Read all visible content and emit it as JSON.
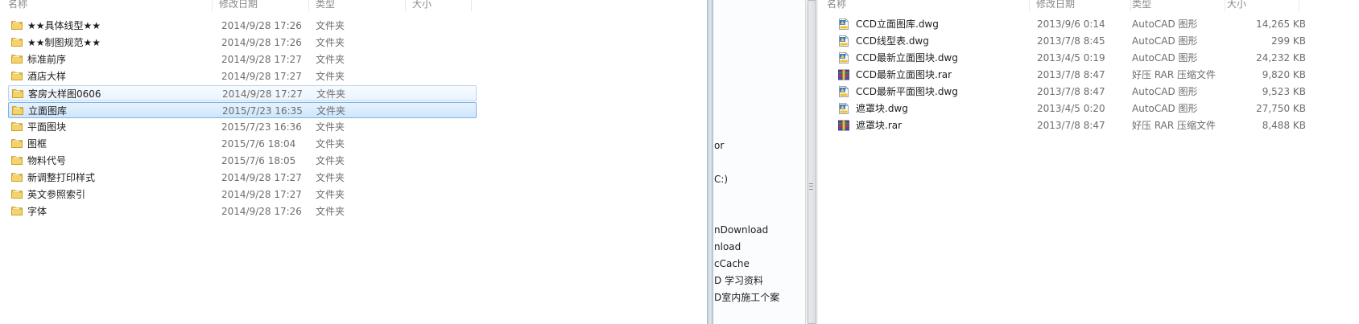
{
  "left_pane": {
    "columns": [
      "名称",
      "修改日期",
      "类型",
      "大小"
    ],
    "rows": [
      {
        "name": "★★具体线型★★",
        "date": "2014/9/28 17:26",
        "type": "文件夹"
      },
      {
        "name": "★★制图规范★★",
        "date": "2014/9/28 17:26",
        "type": "文件夹"
      },
      {
        "name": "标准前序",
        "date": "2014/9/28 17:27",
        "type": "文件夹"
      },
      {
        "name": "酒店大样",
        "date": "2014/9/28 17:27",
        "type": "文件夹"
      },
      {
        "name": "客房大样图0606",
        "date": "2014/9/28 17:27",
        "type": "文件夹"
      },
      {
        "name": "立面图库",
        "date": "2015/7/23 16:35",
        "type": "文件夹"
      },
      {
        "name": "平面图块",
        "date": "2015/7/23 16:36",
        "type": "文件夹"
      },
      {
        "name": "图框",
        "date": "2015/7/6 18:04",
        "type": "文件夹"
      },
      {
        "name": "物料代号",
        "date": "2015/7/6 18:05",
        "type": "文件夹"
      },
      {
        "name": "新调整打印样式",
        "date": "2014/9/28 17:27",
        "type": "文件夹"
      },
      {
        "name": "英文参照索引",
        "date": "2014/9/28 17:27",
        "type": "文件夹"
      },
      {
        "name": "字体",
        "date": "2014/9/28 17:26",
        "type": "文件夹"
      }
    ],
    "hover_row": 4,
    "selected_row": 5
  },
  "nav_pane": {
    "items": [
      "or",
      "C:)",
      "nDownload",
      "nload",
      "cCache",
      "D 学习资料",
      "D室内施工个案"
    ]
  },
  "right_pane": {
    "columns": [
      "名称",
      "修改日期",
      "类型",
      "大小"
    ],
    "rows": [
      {
        "name": "CCD立面图库.dwg",
        "date": "2013/9/6 0:14",
        "type": "AutoCAD 图形",
        "size": "14,265 KB",
        "icon": "dwg-icon"
      },
      {
        "name": "CCD线型表.dwg",
        "date": "2013/7/8 8:45",
        "type": "AutoCAD 图形",
        "size": "299 KB",
        "icon": "dwg-icon"
      },
      {
        "name": "CCD最新立面图块.dwg",
        "date": "2013/4/5 0:19",
        "type": "AutoCAD 图形",
        "size": "24,232 KB",
        "icon": "dwg-icon"
      },
      {
        "name": "CCD最新立面图块.rar",
        "date": "2013/7/8 8:47",
        "type": "好压 RAR 压缩文件",
        "size": "9,820 KB",
        "icon": "rar-icon"
      },
      {
        "name": "CCD最新平面图块.dwg",
        "date": "2013/7/8 8:47",
        "type": "AutoCAD 图形",
        "size": "9,523 KB",
        "icon": "dwg-icon"
      },
      {
        "name": "遮罩块.dwg",
        "date": "2013/4/5 0:20",
        "type": "AutoCAD 图形",
        "size": "27,750 KB",
        "icon": "dwg-icon"
      },
      {
        "name": "遮罩块.rar",
        "date": "2013/7/8 8:47",
        "type": "好压 RAR 压缩文件",
        "size": "8,488 KB",
        "icon": "rar-icon"
      }
    ]
  },
  "colors": {
    "hover_border": "#b9d6ee",
    "selected_border": "#7fb3e4",
    "folder_yellow": "#f2c94c",
    "splitter": "#a9b7c6"
  }
}
